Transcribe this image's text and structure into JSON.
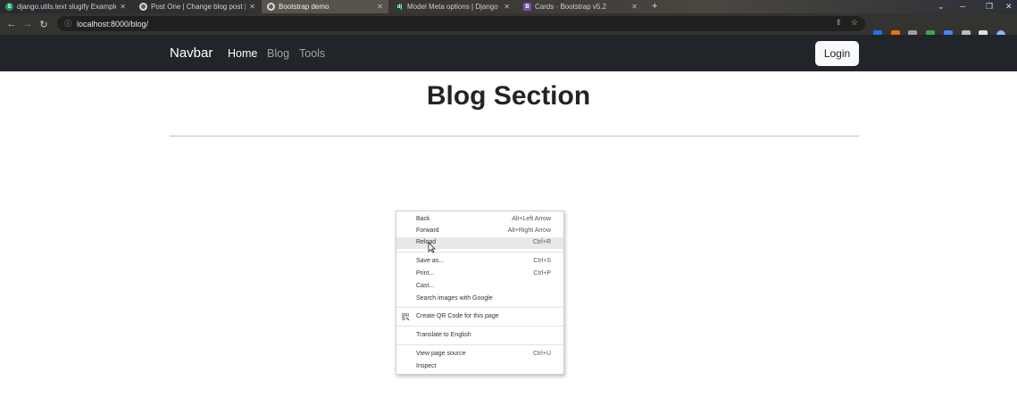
{
  "browser": {
    "tabs": [
      {
        "title": "django.utils.text slugify Example",
        "icon": "S",
        "icon_color": "#1f9a5b",
        "active": false
      },
      {
        "title": "Post One | Change blog post | Dj",
        "icon": "globe",
        "icon_color": "#d8d8d8",
        "active": false
      },
      {
        "title": "Bootstrap demo",
        "icon": "globe",
        "icon_color": "#d8d8d8",
        "active": true
      },
      {
        "title": "Model Meta options | Django do",
        "icon": "dj",
        "icon_color": "#0c4b33",
        "active": false
      },
      {
        "title": "Cards · Bootstrap v5.2",
        "icon": "B",
        "icon_color": "#7952b3",
        "active": false
      }
    ],
    "new_tab": "+",
    "url": "localhost:8000/blog/"
  },
  "navbar": {
    "brand": "Navbar",
    "links": [
      {
        "label": "Home",
        "active": true
      },
      {
        "label": "Blog",
        "active": false
      },
      {
        "label": "Tools",
        "active": false
      }
    ],
    "login_label": "Login"
  },
  "main": {
    "heading": "Blog Section"
  },
  "context_menu": {
    "items": [
      {
        "label": "Back",
        "shortcut": "Alt+Left Arrow",
        "disabled": false
      },
      {
        "label": "Forward",
        "shortcut": "Alt+Right Arrow",
        "disabled": false
      },
      {
        "label": "Reload",
        "shortcut": "Ctrl+R",
        "hover": true
      },
      {
        "label": "Save as...",
        "shortcut": "Ctrl+S"
      },
      {
        "label": "Print...",
        "shortcut": "Ctrl+P"
      },
      {
        "label": "Cast..."
      },
      {
        "label": "Search images with Google"
      },
      {
        "label": "Create QR Code for this page",
        "icon": "qr-code-icon"
      },
      {
        "label": "Translate to English"
      },
      {
        "label": "View page source",
        "shortcut": "Ctrl+U"
      },
      {
        "label": "Inspect"
      }
    ]
  },
  "colors": {
    "navbar_bg": "#212529",
    "nav_active": "#ffffff",
    "nav_inactive": "#9da3a9",
    "login_bg": "#f8f9fa"
  }
}
